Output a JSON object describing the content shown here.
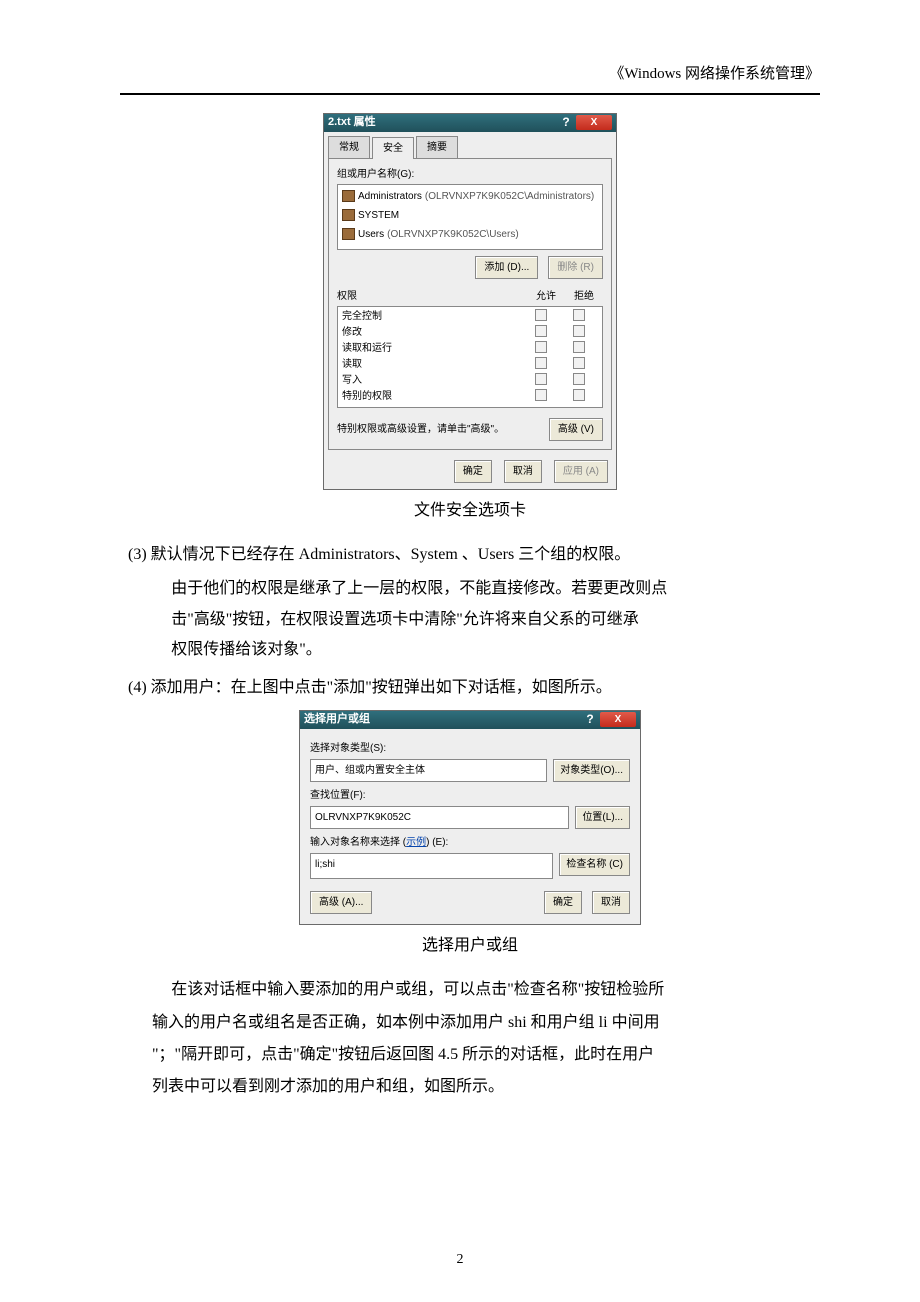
{
  "header": {
    "title": "《Windows 网络操作系统管理》"
  },
  "dialog1": {
    "title": "2.txt 属性",
    "help": "?",
    "close": "X",
    "tabs": {
      "general": "常规",
      "security": "安全",
      "summary": "摘要"
    },
    "groups_label": "组或用户名称(G):",
    "groups": {
      "admins_name": "Administrators",
      "admins_suffix": "(OLRVNXP7K9K052C\\Administrators)",
      "system": "SYSTEM",
      "users_name": "Users",
      "users_suffix": "(OLRVNXP7K9K052C\\Users)"
    },
    "add_btn": "添加 (D)...",
    "remove_btn": "删除 (R)",
    "perm_header": {
      "label": "权限",
      "allow": "允许",
      "deny": "拒绝"
    },
    "perms": {
      "full": "完全控制",
      "modify": "修改",
      "readexec": "读取和运行",
      "read": "读取",
      "write": "写入",
      "special": "特别的权限"
    },
    "advanced_text": "特别权限或高级设置，请单击\"高级\"。",
    "advanced_btn": "高级 (V)",
    "ok": "确定",
    "cancel": "取消",
    "apply": "应用 (A)"
  },
  "caption1": "文件安全选项卡",
  "body": {
    "item3_num": "(3)",
    "item3_line1": "默认情况下已经存在 Administrators、System 、Users 三个组的权限。",
    "item3_line2": "由于他们的权限是继承了上一层的权限，不能直接修改。若要更改则点",
    "item3_line3": "击\"高级\"按钮，在权限设置选项卡中清除\"允许将来自父系的可继承",
    "item3_line4": "权限传播给该对象\"。",
    "item4_num": "(4)",
    "item4_text": "添加用户：在上图中点击\"添加\"按钮弹出如下对话框，如图所示。"
  },
  "dialog2": {
    "title": "选择用户或组",
    "objtype_label": "选择对象类型(S):",
    "objtype_value": "用户、组或内置安全主体",
    "objtype_btn": "对象类型(O)...",
    "loc_label": "查找位置(F):",
    "loc_value": "OLRVNXP7K9K052C",
    "loc_btn": "位置(L)...",
    "names_label_1": "输入对象名称来选择 (",
    "names_label_link": "示例",
    "names_label_2": ") (E):",
    "names_value": "li;shi",
    "check_btn": "检查名称 (C)",
    "adv_btn": "高级 (A)...",
    "ok": "确定",
    "cancel": "取消"
  },
  "caption2": "选择用户或组",
  "para2": {
    "l1": "在该对话框中输入要添加的用户或组，可以点击\"检查名称\"按钮检验所",
    "l2": "输入的用户名或组名是否正确，如本例中添加用户 shi 和用户组 li 中间用",
    "l3": "\"；\"隔开即可，点击\"确定\"按钮后返回图 4.5 所示的对话框，此时在用户",
    "l4": "列表中可以看到刚才添加的用户和组，如图所示。"
  },
  "page_number": "2"
}
